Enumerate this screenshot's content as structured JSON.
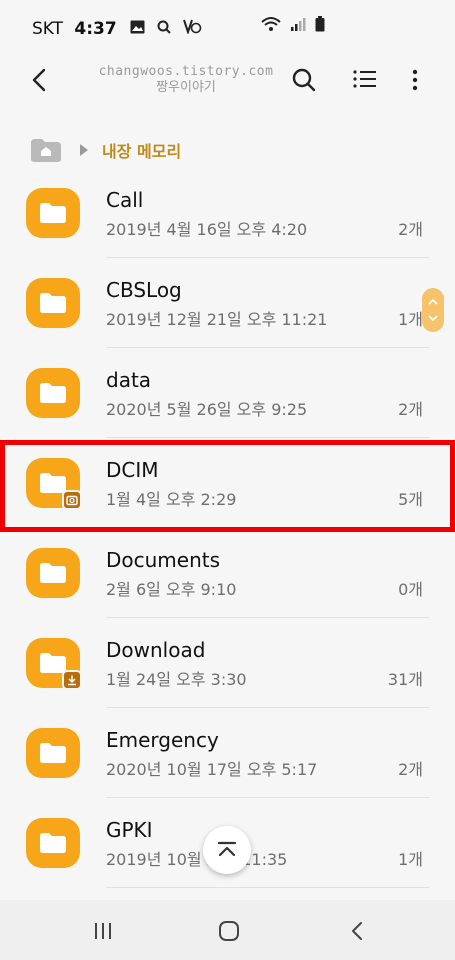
{
  "status_bar": {
    "carrier": "SKT",
    "time": "4:37"
  },
  "toolbar": {
    "watermark_line1": "changwoos.tistory.com",
    "watermark_line2": "짱우이야기"
  },
  "breadcrumb": {
    "label": "내장 메모리"
  },
  "files": [
    {
      "name": "Call",
      "date": "2019년 4월 16일 오후 4:20",
      "count": "2개"
    },
    {
      "name": "CBSLog",
      "date": "2019년 12월 21일 오후 11:21",
      "count": "1개"
    },
    {
      "name": "data",
      "date": "2020년 5월 26일 오후 9:25",
      "count": "2개"
    },
    {
      "name": "DCIM",
      "date": "1월 4일 오후 2:29",
      "count": "5개"
    },
    {
      "name": "Documents",
      "date": "2월 6일 오후 9:10",
      "count": "0개"
    },
    {
      "name": "Download",
      "date": "1월 24일 오후 3:30",
      "count": "31개"
    },
    {
      "name": "Emergency",
      "date": "2020년 10월 17일 오후 5:17",
      "count": "2개"
    },
    {
      "name": "GPKI",
      "date": "2019년 10월 오후 11:35",
      "count": "1개"
    }
  ],
  "colors": {
    "folder": "#f8a619",
    "breadcrumb_accent": "#c08a1a",
    "highlight": "#ee0000"
  }
}
